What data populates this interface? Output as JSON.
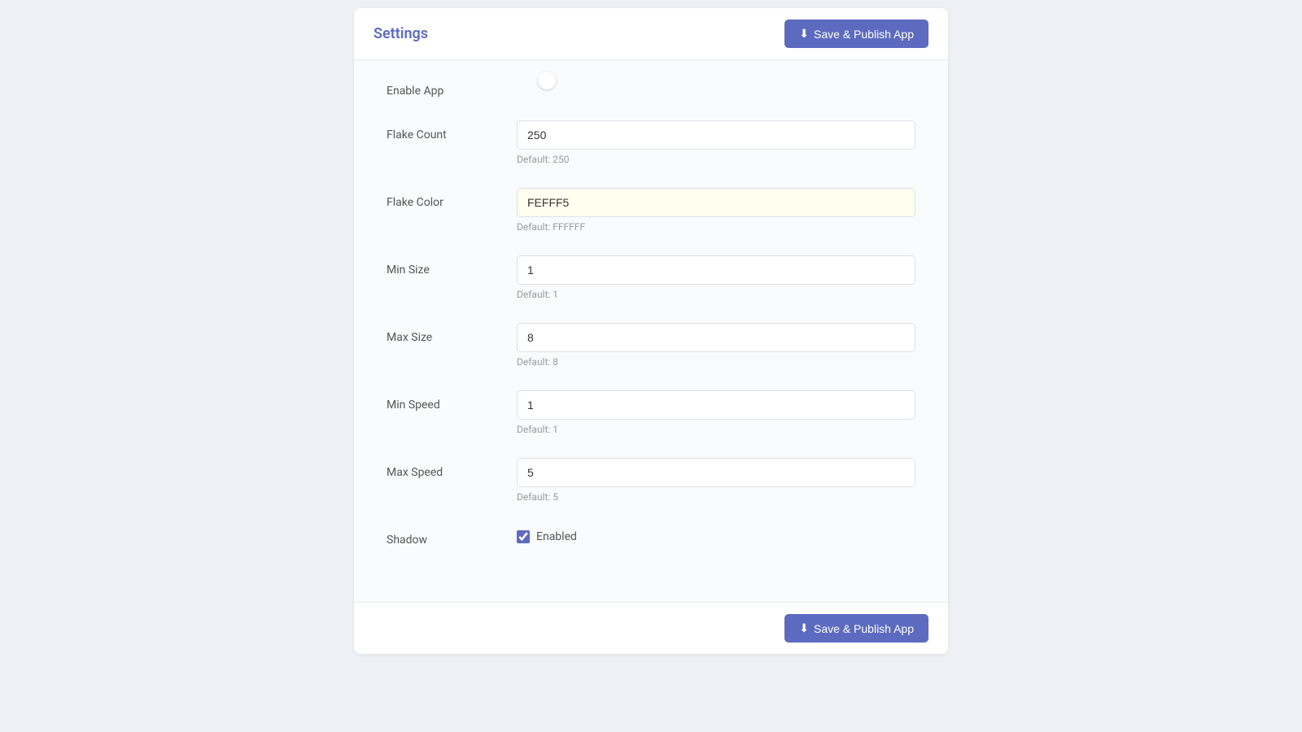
{
  "header": {
    "title": "Settings",
    "save_publish_label": "Save & Publish App",
    "save_publish_icon": "⬇"
  },
  "footer": {
    "save_publish_label": "Save & Publish App",
    "save_publish_icon": "⬇"
  },
  "form": {
    "enable_app": {
      "label": "Enable App",
      "value": true
    },
    "flake_count": {
      "label": "Flake Count",
      "value": "250",
      "default": "Default: 250"
    },
    "flake_color": {
      "label": "Flake Color",
      "value": "FEFFF5",
      "default": "Default: FFFFFF"
    },
    "min_size": {
      "label": "Min Size",
      "value": "1",
      "default": "Default: 1"
    },
    "max_size": {
      "label": "Max Size",
      "value": "8",
      "default": "Default: 8"
    },
    "min_speed": {
      "label": "Min Speed",
      "value": "1",
      "default": "Default: 1"
    },
    "max_speed": {
      "label": "Max Speed",
      "value": "5",
      "default": "Default: 5"
    },
    "shadow": {
      "label": "Shadow",
      "checked": true,
      "checkbox_label": "Enabled"
    }
  }
}
